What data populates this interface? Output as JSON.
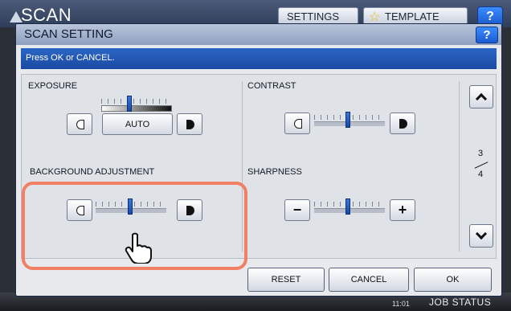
{
  "background": {
    "title": "SCAN",
    "settings_label": "SETTINGS",
    "template_label": "TEMPLATE",
    "help_label": "?",
    "clock": "11:01",
    "job_status_label": "JOB STATUS"
  },
  "dialog": {
    "title": "SCAN SETTING",
    "help_label": "?",
    "message": "Press OK or CANCEL.",
    "exposure": {
      "label": "EXPOSURE",
      "auto_label": "AUTO",
      "level": 0.5
    },
    "contrast": {
      "label": "CONTRAST",
      "level": 0.5
    },
    "background_adjustment": {
      "label": "BACKGROUND ADJUSTMENT",
      "level": 0.5
    },
    "sharpness": {
      "label": "SHARPNESS",
      "minus_label": "−",
      "plus_label": "+",
      "level": 0.5
    },
    "pager": {
      "current": "3",
      "total": "4"
    },
    "buttons": {
      "reset": "RESET",
      "cancel": "CANCEL",
      "ok": "OK"
    }
  },
  "colors": {
    "highlight": "#f07f63",
    "accent": "#1a4aa3"
  }
}
